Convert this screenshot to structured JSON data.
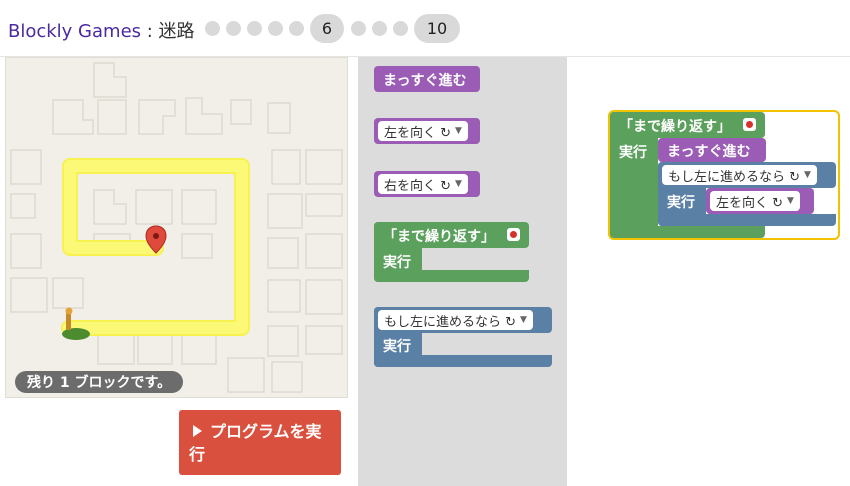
{
  "header": {
    "app_name": "Blockly Games",
    "separator": " : ",
    "game_name": "迷路",
    "levels": {
      "before": 5,
      "current": "6",
      "between": 3,
      "last": "10"
    }
  },
  "maze": {
    "status": "残り 1 ブロックです。"
  },
  "run_button": {
    "label": "プログラムを実行"
  },
  "toolbox": {
    "move_forward": "まっすぐ進む",
    "turn_left": "左を向く ↻",
    "turn_right": "右を向く ↻",
    "repeat_until": "「まで繰り返す」",
    "repeat_do": "実行",
    "if_path": "もし左に進めるなら ↻",
    "if_do": "実行"
  },
  "workspace": {
    "repeat_until": "「まで繰り返す」",
    "repeat_do": "実行",
    "move_forward": "まっすぐ進む",
    "if_path": "もし左に進めるなら ↻",
    "if_do": "実行",
    "turn_left": "左を向く ↻"
  },
  "colors": {
    "motion": "#9a5cb4",
    "loop": "#5ba05d",
    "logic": "#5b80a5",
    "path": "#fafa4b",
    "run": "#d9503e"
  }
}
